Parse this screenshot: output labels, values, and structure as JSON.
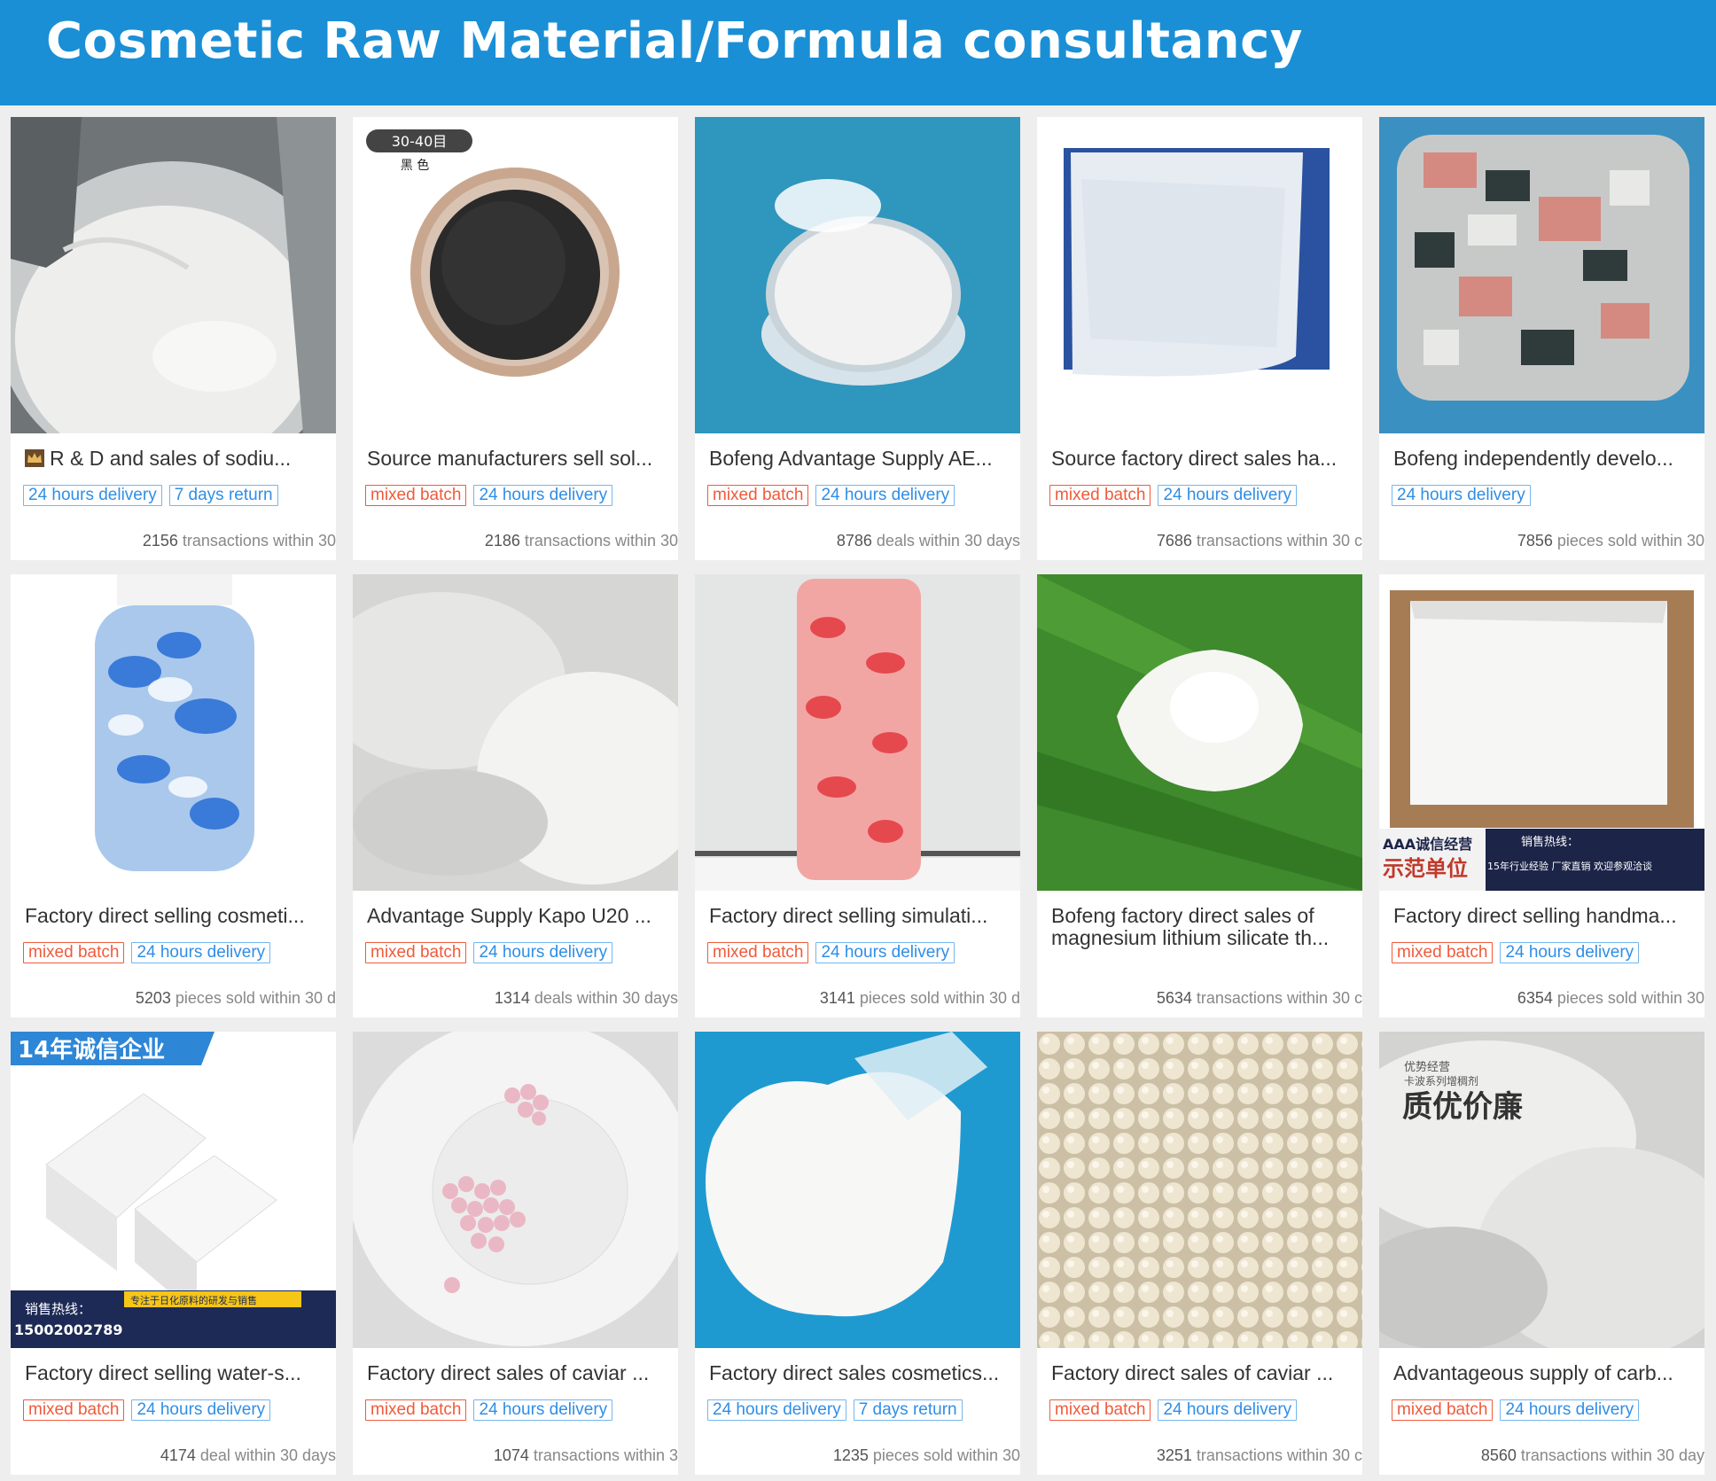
{
  "header": {
    "title": "Cosmetic Raw Material/Formula consultancy"
  },
  "products": [
    {
      "title": "R & D and sales of sodiu...",
      "tags": [
        "24 hours delivery",
        "7 days return"
      ],
      "stats_num": "2156",
      "stats_text": " transactions within 30"
    },
    {
      "title": "Source manufacturers sell sol...",
      "tags": [
        "mixed batch",
        "24 hours delivery"
      ],
      "stats_num": "2186",
      "stats_text": " transactions within 30",
      "image_caption": "30-40目",
      "image_caption2": "黑 色"
    },
    {
      "title": "Bofeng Advantage Supply AE...",
      "tags": [
        "mixed batch",
        "24 hours delivery"
      ],
      "stats_num": "8786",
      "stats_text": " deals within 30 days"
    },
    {
      "title": "Source factory direct sales ha...",
      "tags": [
        "mixed batch",
        "24 hours delivery"
      ],
      "stats_num": "7686",
      "stats_text": " transactions within 30 c"
    },
    {
      "title": "Bofeng independently develo...",
      "tags": [
        "24 hours delivery"
      ],
      "stats_num": "7856",
      "stats_text": " pieces sold within 30"
    },
    {
      "title": "Factory direct selling cosmeti...",
      "tags": [
        "mixed batch",
        "24 hours delivery"
      ],
      "stats_num": "5203",
      "stats_text": " pieces sold within 30 d"
    },
    {
      "title": "Advantage Supply Kapo U20 ...",
      "tags": [
        "mixed batch",
        "24 hours delivery"
      ],
      "stats_num": "1314",
      "stats_text": " deals within 30 days"
    },
    {
      "title": "Factory direct selling simulati...",
      "tags": [
        "mixed batch",
        "24 hours delivery"
      ],
      "stats_num": "3141",
      "stats_text": " pieces sold within 30 d"
    },
    {
      "title": "Bofeng factory direct sales of magnesium lithium silicate th...",
      "tags": [],
      "stats_num": "5634",
      "stats_text": " transactions within 30 c"
    },
    {
      "title": "Factory direct selling handma...",
      "tags": [
        "mixed batch",
        "24 hours delivery"
      ],
      "stats_num": "6354",
      "stats_text": " pieces sold within 30",
      "banner_left": "AAA诚信经营",
      "banner_left2": "示范单位",
      "banner_right": "销售热线：",
      "banner_right2": "15年行业经验  厂家直销  欢迎参观洽谈"
    },
    {
      "title": "Factory direct selling water-s...",
      "tags": [
        "mixed batch",
        "24 hours delivery"
      ],
      "stats_num": "4174",
      "stats_text": " deal within 30 days",
      "banner_top": "14年诚信企业",
      "banner_hotline": "销售热线：",
      "banner_phone": "15002002789",
      "banner_slogan": "专注于日化原料的研发与销售"
    },
    {
      "title": "Factory direct sales of caviar ...",
      "tags": [
        "mixed batch",
        "24 hours delivery"
      ],
      "stats_num": "1074",
      "stats_text": " transactions within 3"
    },
    {
      "title": "Factory direct sales cosmetics...",
      "tags": [
        "24 hours delivery",
        "7 days return"
      ],
      "stats_num": "1235",
      "stats_text": " pieces sold within 30"
    },
    {
      "title": "Factory direct sales of caviar ...",
      "tags": [
        "mixed batch",
        "24 hours delivery"
      ],
      "stats_num": "3251",
      "stats_text": " transactions within 30 c"
    },
    {
      "title": "Advantageous supply of carb...",
      "tags": [
        "mixed batch",
        "24 hours delivery"
      ],
      "stats_num": "8560",
      "stats_text": " transactions within 30 day",
      "image_caption": "优势经营",
      "image_caption2": "卡波系列增稠剂",
      "image_caption3": "质优价廉"
    }
  ],
  "colors": {
    "header_bg": "#1a8fd6",
    "tag_red": "#f05a3a",
    "tag_blue": "#2f8ee6"
  }
}
